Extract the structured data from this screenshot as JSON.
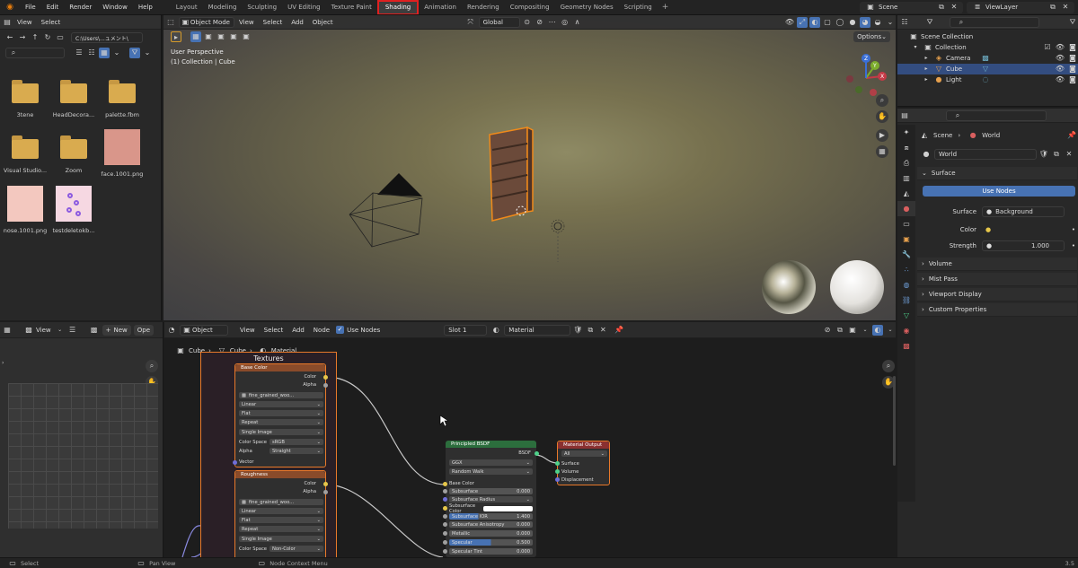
{
  "topbar": {
    "menus": [
      "File",
      "Edit",
      "Render",
      "Window",
      "Help"
    ],
    "workspaces": [
      "Layout",
      "Modeling",
      "Sculpting",
      "UV Editing",
      "Texture Paint",
      "Shading",
      "Animation",
      "Rendering",
      "Compositing",
      "Geometry Nodes",
      "Scripting"
    ],
    "active_workspace": "Shading",
    "add": "+",
    "scene": "Scene",
    "view_layer": "ViewLayer"
  },
  "file_browser": {
    "view": "View",
    "select": "Select",
    "path": "C:\\Users\\...ュメント\\",
    "items": [
      {
        "name": "3tene",
        "kind": "folder"
      },
      {
        "name": "HeadDecora...",
        "kind": "folder"
      },
      {
        "name": "palette.fbm",
        "kind": "folder"
      },
      {
        "name": "Visual Studio...",
        "kind": "folder"
      },
      {
        "name": "Zoom",
        "kind": "folder"
      },
      {
        "name": "face.1001.png",
        "kind": "image"
      },
      {
        "name": "nose.1001.png",
        "kind": "image"
      },
      {
        "name": "testdeletokb...",
        "kind": "image"
      }
    ]
  },
  "viewport": {
    "mode": "Object Mode",
    "menus": [
      "View",
      "Select",
      "Add",
      "Object"
    ],
    "transform": "Global",
    "options": "Options",
    "info_line1": "User Perspective",
    "info_line2": "(1) Collection | Cube",
    "gizmo": {
      "x": "X",
      "y": "Y",
      "z": "Z"
    }
  },
  "outliner": {
    "root": "Scene Collection",
    "collection": "Collection",
    "items": [
      "Camera",
      "Cube",
      "Light"
    ]
  },
  "properties": {
    "breadcrumb_scene": "Scene",
    "breadcrumb_world": "World",
    "world_name": "World",
    "surface_panel": "Surface",
    "use_nodes": "Use Nodes",
    "surface_label": "Surface",
    "surface_value": "Background",
    "color_label": "Color",
    "strength_label": "Strength",
    "strength_value": "1.000",
    "collapsed_panels": [
      "Volume",
      "Mist Pass",
      "Viewport Display",
      "Custom Properties"
    ]
  },
  "image_editor": {
    "view": "View",
    "new": "New",
    "open": "Ope"
  },
  "node_editor": {
    "object": "Object",
    "menus": [
      "View",
      "Select",
      "Add",
      "Node"
    ],
    "use_nodes": "Use Nodes",
    "slot": "Slot 1",
    "material": "Material",
    "breadcrumb": [
      "Cube",
      "Cube",
      "Material"
    ],
    "frame_label": "Textures",
    "base_color_node": {
      "title": "Base Color",
      "out_color": "Color",
      "out_alpha": "Alpha",
      "image": "fine_grained_woo...",
      "interp": "Linear",
      "proj": "Flat",
      "ext": "Repeat",
      "source": "Single Image",
      "cs_label": "Color Space",
      "cs_value": "sRGB",
      "alpha_label": "Alpha",
      "alpha_value": "Straight",
      "vector": "Vector"
    },
    "roughness_node": {
      "title": "Roughness",
      "out_color": "Color",
      "out_alpha": "Alpha",
      "image": "fine_grained_woo...",
      "interp": "Linear",
      "proj": "Flat",
      "ext": "Repeat",
      "source": "Single Image",
      "cs_label": "Color Space",
      "cs_value": "Non-Color"
    },
    "bsdf_node": {
      "title": "Principled BSDF",
      "out": "BSDF",
      "dist": "GGX",
      "sss": "Random Walk",
      "rows": [
        {
          "label": "Base Color",
          "value": ""
        },
        {
          "label": "Subsurface",
          "value": "0.000"
        },
        {
          "label": "Subsurface Radius",
          "value": ""
        },
        {
          "label": "Subsurface Color",
          "value": ""
        },
        {
          "label": "Subsurface IOR",
          "value": "1.400"
        },
        {
          "label": "Subsurface Anisotropy",
          "value": "0.000"
        },
        {
          "label": "Metallic",
          "value": "0.000"
        },
        {
          "label": "Specular",
          "value": "0.500"
        },
        {
          "label": "Specular Tint",
          "value": "0.000"
        }
      ]
    },
    "output_node": {
      "title": "Material Output",
      "target": "All",
      "inputs": [
        "Surface",
        "Volume",
        "Displacement"
      ]
    }
  },
  "statusbar": {
    "select": "Select",
    "pan": "Pan View",
    "context": "Node Context Menu",
    "version": "3.5"
  }
}
